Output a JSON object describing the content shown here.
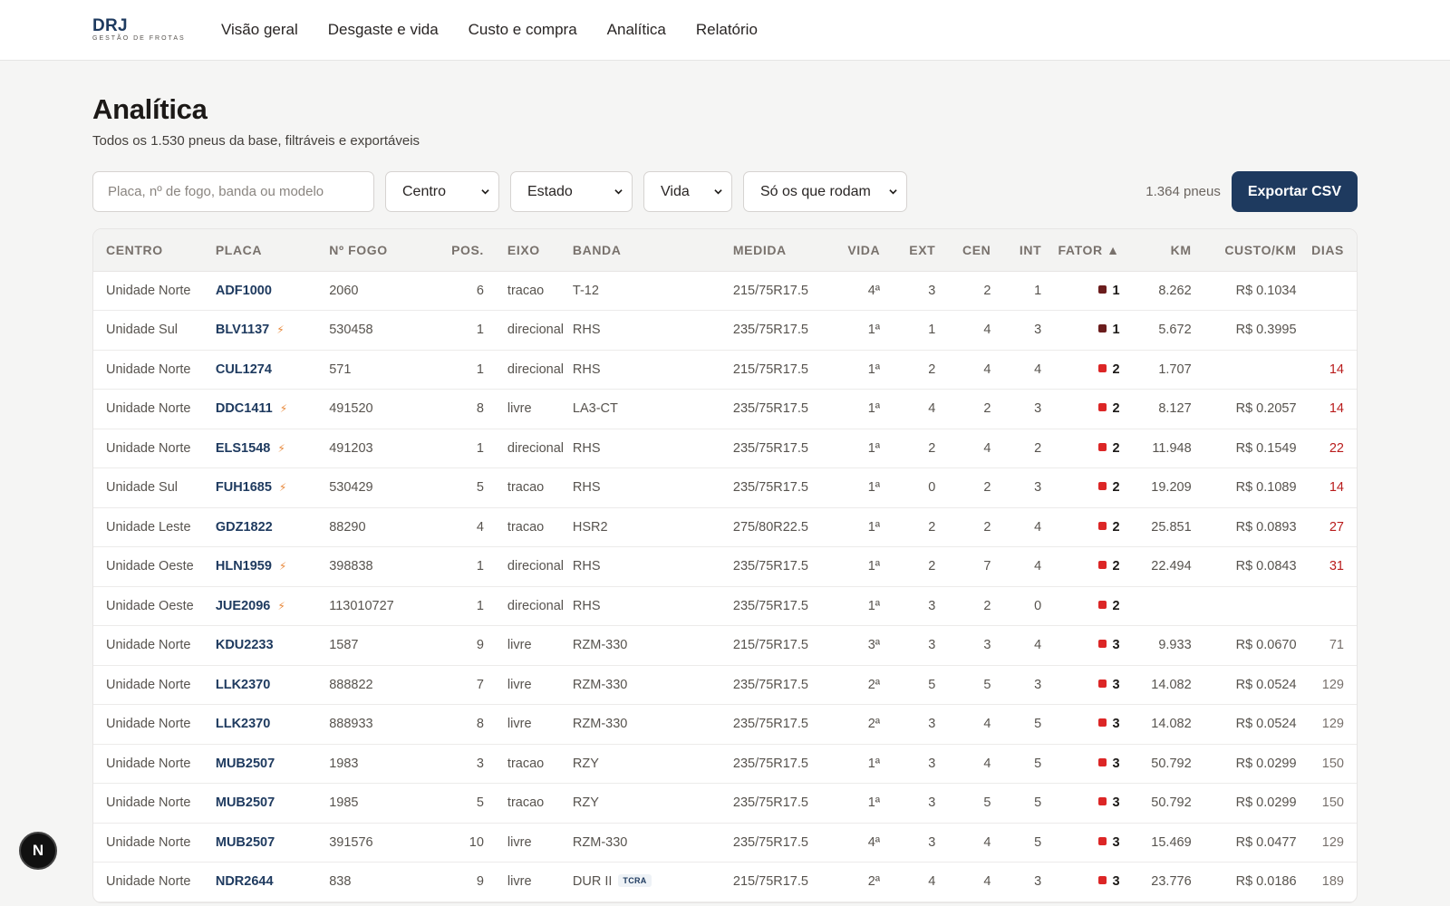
{
  "brand": {
    "name": "DRJ",
    "tagline": "GESTÃO DE FROTAS"
  },
  "nav": [
    {
      "label": "Visão geral"
    },
    {
      "label": "Desgaste e vida"
    },
    {
      "label": "Custo e compra"
    },
    {
      "label": "Analítica"
    },
    {
      "label": "Relatório"
    }
  ],
  "page": {
    "title": "Analítica",
    "subtitle": "Todos os 1.530 pneus da base, filtráveis e exportáveis"
  },
  "filters": {
    "search_placeholder": "Placa, nº de fogo, banda ou modelo",
    "centro": "Centro",
    "estado": "Estado",
    "vida": "Vida",
    "rodam": "Só os que rodam",
    "count": "1.364 pneus",
    "export_label": "Exportar CSV"
  },
  "colors": {
    "accent": "#1e3a5f",
    "fator1": "#6b1d1d",
    "fator2": "#dc2626",
    "fator3": "#dc2626",
    "bolt": "#e8883a",
    "dias_alert": "#b91c1c"
  },
  "table": {
    "headers": {
      "centro": "CENTRO",
      "placa": "PLACA",
      "fogo": "Nº FOGO",
      "pos": "POS.",
      "eixo": "EIXO",
      "banda": "BANDA",
      "medida": "MEDIDA",
      "vida": "VIDA",
      "ext": "EXT",
      "cen": "CEN",
      "int": "INT",
      "fator": "FATOR ▲",
      "km": "KM",
      "custo": "CUSTO/KM",
      "dias": "DIAS"
    },
    "rows": [
      {
        "centro": "Unidade Norte",
        "placa": "ADF1000",
        "bolt": false,
        "fogo": "2060",
        "pos": "6",
        "eixo": "tracao",
        "banda": "T-12",
        "tag": "",
        "medida": "215/75R17.5",
        "vida": "4ª",
        "ext": "3",
        "cen": "2",
        "int": "1",
        "fator": "1",
        "km": "8.262",
        "custo": "R$ 0.1034",
        "dias": "",
        "dias_alert": false
      },
      {
        "centro": "Unidade Sul",
        "placa": "BLV1137",
        "bolt": true,
        "fogo": "530458",
        "pos": "1",
        "eixo": "direcional",
        "banda": "RHS",
        "tag": "",
        "medida": "235/75R17.5",
        "vida": "1ª",
        "ext": "1",
        "cen": "4",
        "int": "3",
        "fator": "1",
        "km": "5.672",
        "custo": "R$ 0.3995",
        "dias": "",
        "dias_alert": false
      },
      {
        "centro": "Unidade Norte",
        "placa": "CUL1274",
        "bolt": false,
        "fogo": "571",
        "pos": "1",
        "eixo": "direcional",
        "banda": "RHS",
        "tag": "",
        "medida": "215/75R17.5",
        "vida": "1ª",
        "ext": "2",
        "cen": "4",
        "int": "4",
        "fator": "2",
        "km": "1.707",
        "custo": "",
        "dias": "14",
        "dias_alert": true
      },
      {
        "centro": "Unidade Norte",
        "placa": "DDC1411",
        "bolt": true,
        "fogo": "491520",
        "pos": "8",
        "eixo": "livre",
        "banda": "LA3-CT",
        "tag": "",
        "medida": "235/75R17.5",
        "vida": "1ª",
        "ext": "4",
        "cen": "2",
        "int": "3",
        "fator": "2",
        "km": "8.127",
        "custo": "R$ 0.2057",
        "dias": "14",
        "dias_alert": true
      },
      {
        "centro": "Unidade Norte",
        "placa": "ELS1548",
        "bolt": true,
        "fogo": "491203",
        "pos": "1",
        "eixo": "direcional",
        "banda": "RHS",
        "tag": "",
        "medida": "235/75R17.5",
        "vida": "1ª",
        "ext": "2",
        "cen": "4",
        "int": "2",
        "fator": "2",
        "km": "11.948",
        "custo": "R$ 0.1549",
        "dias": "22",
        "dias_alert": true
      },
      {
        "centro": "Unidade Sul",
        "placa": "FUH1685",
        "bolt": true,
        "fogo": "530429",
        "pos": "5",
        "eixo": "tracao",
        "banda": "RHS",
        "tag": "",
        "medida": "235/75R17.5",
        "vida": "1ª",
        "ext": "0",
        "cen": "2",
        "int": "3",
        "fator": "2",
        "km": "19.209",
        "custo": "R$ 0.1089",
        "dias": "14",
        "dias_alert": true
      },
      {
        "centro": "Unidade Leste",
        "placa": "GDZ1822",
        "bolt": false,
        "fogo": "88290",
        "pos": "4",
        "eixo": "tracao",
        "banda": "HSR2",
        "tag": "",
        "medida": "275/80R22.5",
        "vida": "1ª",
        "ext": "2",
        "cen": "2",
        "int": "4",
        "fator": "2",
        "km": "25.851",
        "custo": "R$ 0.0893",
        "dias": "27",
        "dias_alert": true
      },
      {
        "centro": "Unidade Oeste",
        "placa": "HLN1959",
        "bolt": true,
        "fogo": "398838",
        "pos": "1",
        "eixo": "direcional",
        "banda": "RHS",
        "tag": "",
        "medida": "235/75R17.5",
        "vida": "1ª",
        "ext": "2",
        "cen": "7",
        "int": "4",
        "fator": "2",
        "km": "22.494",
        "custo": "R$ 0.0843",
        "dias": "31",
        "dias_alert": true
      },
      {
        "centro": "Unidade Oeste",
        "placa": "JUE2096",
        "bolt": true,
        "fogo": "113010727",
        "pos": "1",
        "eixo": "direcional",
        "banda": "RHS",
        "tag": "",
        "medida": "235/75R17.5",
        "vida": "1ª",
        "ext": "3",
        "cen": "2",
        "int": "0",
        "fator": "2",
        "km": "",
        "custo": "",
        "dias": "",
        "dias_alert": false
      },
      {
        "centro": "Unidade Norte",
        "placa": "KDU2233",
        "bolt": false,
        "fogo": "1587",
        "pos": "9",
        "eixo": "livre",
        "banda": "RZM-330",
        "tag": "",
        "medida": "215/75R17.5",
        "vida": "3ª",
        "ext": "3",
        "cen": "3",
        "int": "4",
        "fator": "3",
        "km": "9.933",
        "custo": "R$ 0.0670",
        "dias": "71",
        "dias_alert": false
      },
      {
        "centro": "Unidade Norte",
        "placa": "LLK2370",
        "bolt": false,
        "fogo": "888822",
        "pos": "7",
        "eixo": "livre",
        "banda": "RZM-330",
        "tag": "",
        "medida": "235/75R17.5",
        "vida": "2ª",
        "ext": "5",
        "cen": "5",
        "int": "3",
        "fator": "3",
        "km": "14.082",
        "custo": "R$ 0.0524",
        "dias": "129",
        "dias_alert": false
      },
      {
        "centro": "Unidade Norte",
        "placa": "LLK2370",
        "bolt": false,
        "fogo": "888933",
        "pos": "8",
        "eixo": "livre",
        "banda": "RZM-330",
        "tag": "",
        "medida": "235/75R17.5",
        "vida": "2ª",
        "ext": "3",
        "cen": "4",
        "int": "5",
        "fator": "3",
        "km": "14.082",
        "custo": "R$ 0.0524",
        "dias": "129",
        "dias_alert": false
      },
      {
        "centro": "Unidade Norte",
        "placa": "MUB2507",
        "bolt": false,
        "fogo": "1983",
        "pos": "3",
        "eixo": "tracao",
        "banda": "RZY",
        "tag": "",
        "medida": "235/75R17.5",
        "vida": "1ª",
        "ext": "3",
        "cen": "4",
        "int": "5",
        "fator": "3",
        "km": "50.792",
        "custo": "R$ 0.0299",
        "dias": "150",
        "dias_alert": false
      },
      {
        "centro": "Unidade Norte",
        "placa": "MUB2507",
        "bolt": false,
        "fogo": "1985",
        "pos": "5",
        "eixo": "tracao",
        "banda": "RZY",
        "tag": "",
        "medida": "235/75R17.5",
        "vida": "1ª",
        "ext": "3",
        "cen": "5",
        "int": "5",
        "fator": "3",
        "km": "50.792",
        "custo": "R$ 0.0299",
        "dias": "150",
        "dias_alert": false
      },
      {
        "centro": "Unidade Norte",
        "placa": "MUB2507",
        "bolt": false,
        "fogo": "391576",
        "pos": "10",
        "eixo": "livre",
        "banda": "RZM-330",
        "tag": "",
        "medida": "235/75R17.5",
        "vida": "4ª",
        "ext": "3",
        "cen": "4",
        "int": "5",
        "fator": "3",
        "km": "15.469",
        "custo": "R$ 0.0477",
        "dias": "129",
        "dias_alert": false
      },
      {
        "centro": "Unidade Norte",
        "placa": "NDR2644",
        "bolt": false,
        "fogo": "838",
        "pos": "9",
        "eixo": "livre",
        "banda": "DUR II",
        "tag": "TCRA",
        "medida": "215/75R17.5",
        "vida": "2ª",
        "ext": "4",
        "cen": "4",
        "int": "3",
        "fator": "3",
        "km": "23.776",
        "custo": "R$ 0.0186",
        "dias": "189",
        "dias_alert": false
      }
    ]
  },
  "badge": {
    "label": "N"
  }
}
